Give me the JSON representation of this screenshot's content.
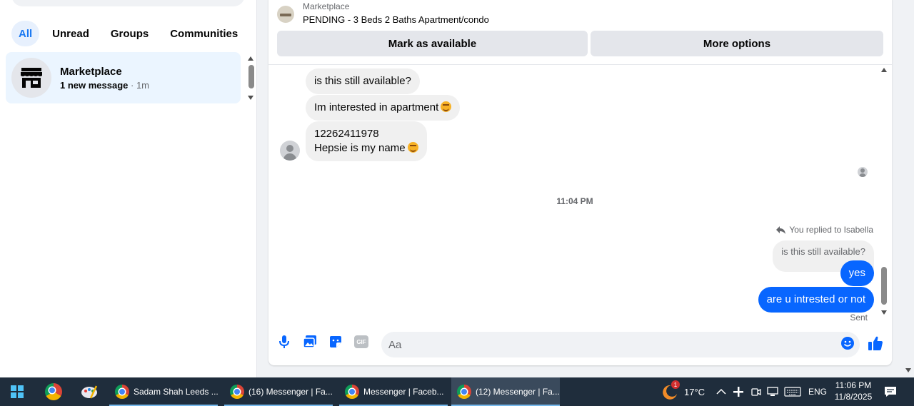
{
  "left_panel": {
    "filters": [
      {
        "label": "All",
        "active": true
      },
      {
        "label": "Unread",
        "active": false
      },
      {
        "label": "Groups",
        "active": false
      },
      {
        "label": "Communities",
        "active": false
      }
    ],
    "chat": {
      "name": "Marketplace",
      "unread_text": "1 new message",
      "separator": " · ",
      "time": "1m",
      "icon": "store-icon"
    }
  },
  "conversation": {
    "listing": {
      "source": "Marketplace",
      "title": "PENDING - 3 Beds 2 Baths Apartment/condo"
    },
    "buttons": {
      "mark_available": "Mark as available",
      "more_options": "More options"
    },
    "incoming": [
      {
        "text": "is this still available?"
      },
      {
        "text": "Im interested in apartment",
        "emoji": "smiling-face"
      },
      {
        "line1": "12262411978",
        "line2": "Hepsie is my name",
        "emoji": "smiling-face"
      }
    ],
    "timestamp": "11:04 PM",
    "reply_label": "You replied to Isabella",
    "quoted_text": "is this still available?",
    "outgoing": [
      {
        "text": "yes"
      },
      {
        "text": "are u intrested or not"
      }
    ],
    "status": "Sent",
    "composer": {
      "placeholder": "Aa",
      "icons": [
        "microphone-icon",
        "photo-icon",
        "sticker-icon",
        "gif-icon",
        "emoji-icon",
        "thumbs-up-icon"
      ],
      "gif_label": "GIF"
    },
    "accent_color": "#0866ff"
  },
  "taskbar": {
    "tasks": [
      {
        "label": "Sadam Shah Leeds ...",
        "active": false
      },
      {
        "label": "(16) Messenger | Fa...",
        "active": false
      },
      {
        "label": "Messenger | Faceb...",
        "active": false
      },
      {
        "label": "(12) Messenger | Fa...",
        "active": true
      }
    ],
    "weather_badge": "1",
    "temperature": "17°C",
    "language": "ENG",
    "time": "11:06 PM",
    "date": "11/8/2025"
  }
}
